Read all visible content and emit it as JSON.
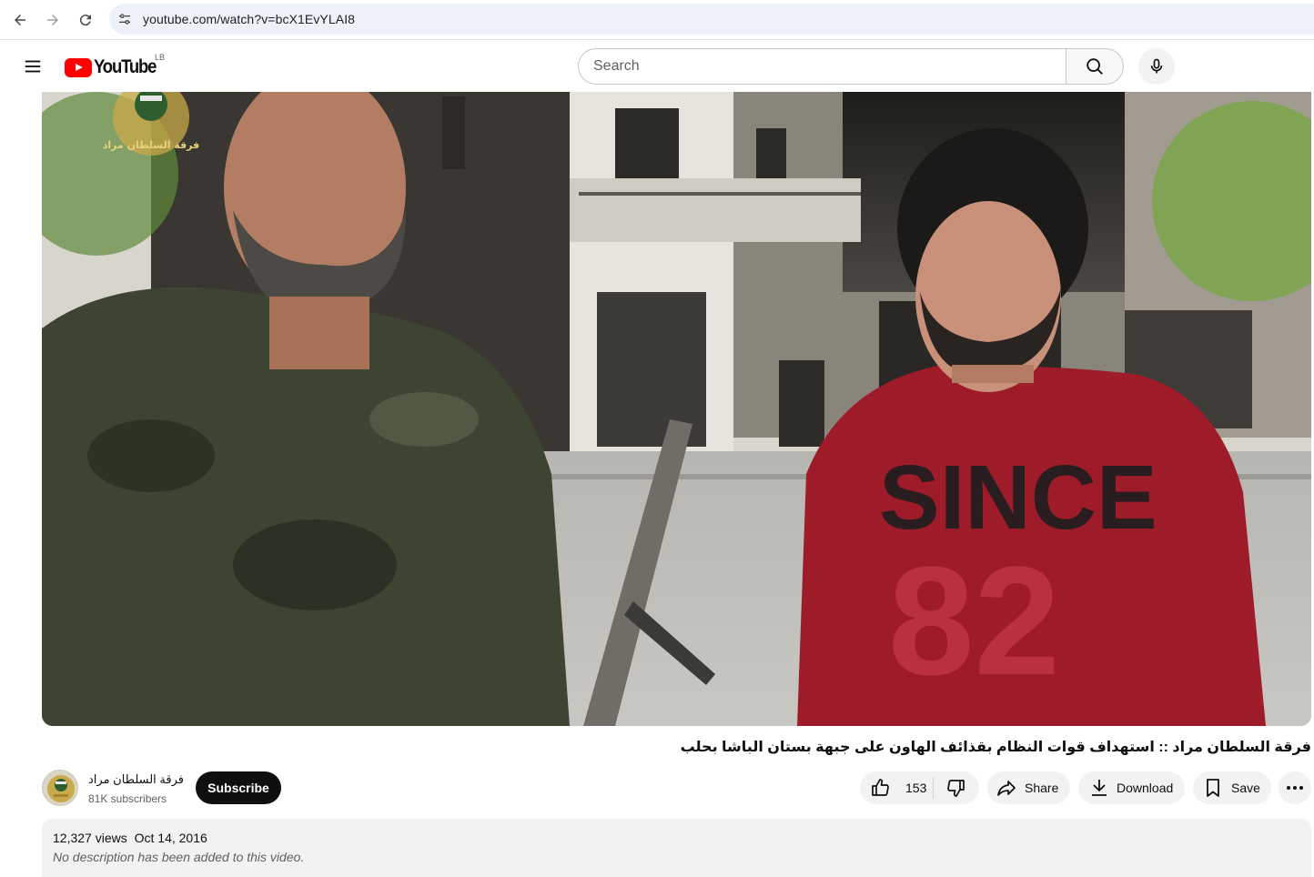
{
  "browser": {
    "url": "youtube.com/watch?v=bcX1EvYLAI8"
  },
  "header": {
    "logo_text": "YouTube",
    "country_code": "LB",
    "search_placeholder": "Search"
  },
  "video": {
    "title": "فرقة السلطان مراد :: استهداف قوات النظام بقذائف الهاون على جبهة بستان الباشا بحلب",
    "overlay_logo_text": "فرقة السلطان مراد",
    "shirt_text_1": "SINCE",
    "shirt_text_2": "82"
  },
  "channel": {
    "name": "فرقة السلطان مراد",
    "subscribers": "81K subscribers",
    "subscribe_label": "Subscribe"
  },
  "actions": {
    "like_count": "153",
    "share_label": "Share",
    "download_label": "Download",
    "save_label": "Save"
  },
  "description": {
    "views": "12,327 views",
    "date": "Oct 14, 2016",
    "text": "No description has been added to this video."
  },
  "icons": {
    "back": "arrow-left-icon",
    "forward": "arrow-right-icon",
    "reload": "reload-icon",
    "site_info": "tune-icon",
    "menu": "hamburger-icon",
    "search": "search-icon",
    "mic": "mic-icon",
    "like": "thumbs-up-icon",
    "dislike": "thumbs-down-icon",
    "share": "share-arrow-icon",
    "download": "download-icon",
    "save": "bookmark-icon",
    "more": "more-horizontal-icon"
  },
  "colors": {
    "brand_red": "#ff0000",
    "subscribe_bg": "#0f0f0f",
    "pill_bg": "#f2f2f2",
    "url_bar_bg": "#edf2fa"
  }
}
